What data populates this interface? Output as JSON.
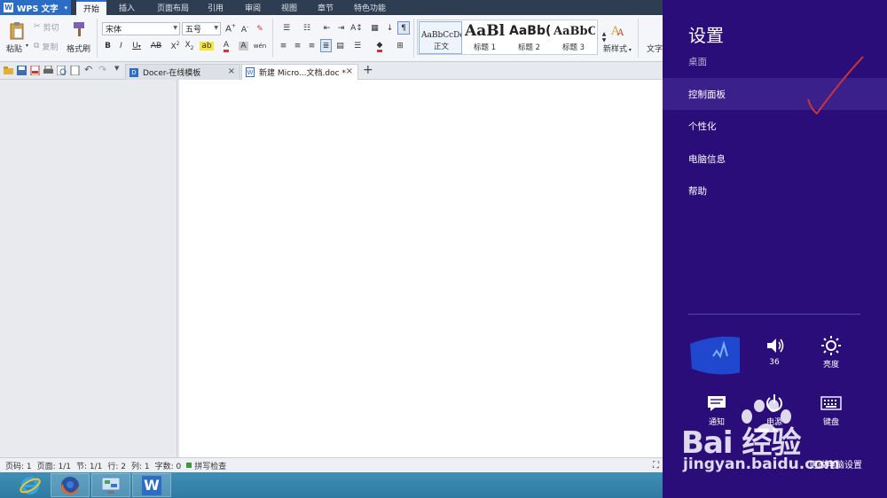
{
  "app": {
    "menu_label": "WPS 文字"
  },
  "ribbon_tabs": [
    {
      "label": "开始",
      "active": true
    },
    {
      "label": "插入"
    },
    {
      "label": "页面布局"
    },
    {
      "label": "引用"
    },
    {
      "label": "审阅"
    },
    {
      "label": "视图"
    },
    {
      "label": "章节"
    },
    {
      "label": "特色功能"
    }
  ],
  "ribbon": {
    "paste": "粘贴",
    "cut": "剪切",
    "copy": "复制",
    "format_painter": "格式刷",
    "font_name": "宋体",
    "font_size": "五号",
    "styles": [
      {
        "preview": "AaBbCcDd",
        "name": "正文"
      },
      {
        "preview": "AaBl",
        "name": "标题 1"
      },
      {
        "preview": "AaBb(",
        "name": "标题 2"
      },
      {
        "preview": "AaBbC",
        "name": "标题 3"
      }
    ],
    "new_style": "新样式",
    "text_tools": "文字"
  },
  "doc_tabs": [
    {
      "label": "Docer-在线模板"
    },
    {
      "label": "新建 Micro...文档.doc *"
    }
  ],
  "status": {
    "page": "页码: 1",
    "pages": "页面: 1/1",
    "section": "节: 1/1",
    "line": "行: 2",
    "column": "列: 1",
    "words": "字数: 0",
    "spell": "拼写检查"
  },
  "charm": {
    "title": "设置",
    "subtitle": "桌面",
    "items": [
      {
        "label": "控制面板"
      },
      {
        "label": "个性化"
      },
      {
        "label": "电脑信息"
      },
      {
        "label": "帮助"
      }
    ],
    "tiles": [
      {
        "label": ""
      },
      {
        "label": "36"
      },
      {
        "label": "亮度"
      },
      {
        "label": "通知"
      },
      {
        "label": "电源"
      },
      {
        "label": "键盘"
      }
    ],
    "change_settings": "更改电脑设置"
  },
  "watermark": {
    "brand": "Bai 经验",
    "url": "jingyan.baidu.com"
  },
  "colors": {
    "charm_bg": "#2b0d79",
    "accent": "#2b6cc4",
    "taskbar": "#3e8fb6"
  }
}
